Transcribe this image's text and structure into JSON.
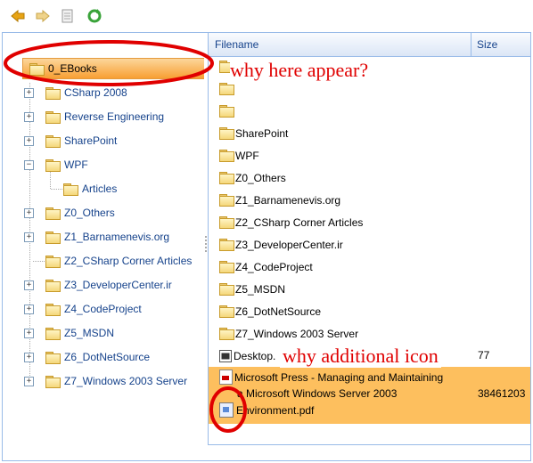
{
  "toolbar": {
    "buttons": [
      {
        "name": "back-button",
        "icon": "arrow-left-icon"
      },
      {
        "name": "forward-button",
        "icon": "arrow-right-icon"
      },
      {
        "name": "properties-button",
        "icon": "document-icon"
      },
      {
        "name": "refresh-button",
        "icon": "refresh-icon"
      }
    ]
  },
  "tree": {
    "selected": "0_EBooks",
    "items": [
      {
        "label": "0_EBooks",
        "expander": ""
      },
      {
        "label": "CSharp 2008",
        "expander": "+"
      },
      {
        "label": "Reverse Engineering",
        "expander": "+"
      },
      {
        "label": "SharePoint",
        "expander": "+"
      },
      {
        "label": "WPF",
        "expander": "−"
      },
      {
        "label": "Articles",
        "expander": ""
      },
      {
        "label": "Z0_Others",
        "expander": "+"
      },
      {
        "label": "Z1_Barnamenevis.org",
        "expander": "+"
      },
      {
        "label": "Z2_CSharp Corner Articles",
        "expander": ""
      },
      {
        "label": "Z3_DeveloperCenter.ir",
        "expander": "+"
      },
      {
        "label": "Z4_CodeProject",
        "expander": "+"
      },
      {
        "label": "Z5_MSDN",
        "expander": "+"
      },
      {
        "label": "Z6_DotNetSource",
        "expander": "+"
      },
      {
        "label": "Z7_Windows 2003 Server",
        "expander": "+"
      }
    ]
  },
  "grid": {
    "columns": {
      "filename": "Filename",
      "size": "Size"
    },
    "rows": [
      {
        "name": "",
        "size": "",
        "icon": "folder-icon"
      },
      {
        "name": "",
        "size": "",
        "icon": "folder-icon"
      },
      {
        "name": "",
        "size": "",
        "icon": "folder-icon"
      },
      {
        "name": "SharePoint",
        "size": "",
        "icon": "folder-icon"
      },
      {
        "name": "WPF",
        "size": "",
        "icon": "folder-icon"
      },
      {
        "name": "Z0_Others",
        "size": "",
        "icon": "folder-icon"
      },
      {
        "name": "Z1_Barnamenevis.org",
        "size": "",
        "icon": "folder-icon"
      },
      {
        "name": "Z2_CSharp Corner Articles",
        "size": "",
        "icon": "folder-icon"
      },
      {
        "name": "Z3_DeveloperCenter.ir",
        "size": "",
        "icon": "folder-icon"
      },
      {
        "name": "Z4_CodeProject",
        "size": "",
        "icon": "folder-icon"
      },
      {
        "name": "Z5_MSDN",
        "size": "",
        "icon": "folder-icon"
      },
      {
        "name": "Z6_DotNetSource",
        "size": "",
        "icon": "folder-icon"
      },
      {
        "name": "Z7_Windows 2003 Server",
        "size": "",
        "icon": "folder-icon"
      },
      {
        "name": "Desktop.",
        "size": "77",
        "icon": "settings-file-icon"
      }
    ],
    "selected_file": {
      "line1": "Microsoft Press - Managing and Maintaining",
      "line2": "a Microsoft Windows Server 2003",
      "line3": "Environment.pdf",
      "size": "38461203",
      "icon": "pdf-icon",
      "extra_icon": "document-icon"
    }
  },
  "annotations": {
    "note1": "why here appear?",
    "note2": "why additional icon"
  },
  "colors": {
    "accent": "#99bbe8",
    "selected": "#fdbf5e",
    "annotation": "#e00000"
  }
}
